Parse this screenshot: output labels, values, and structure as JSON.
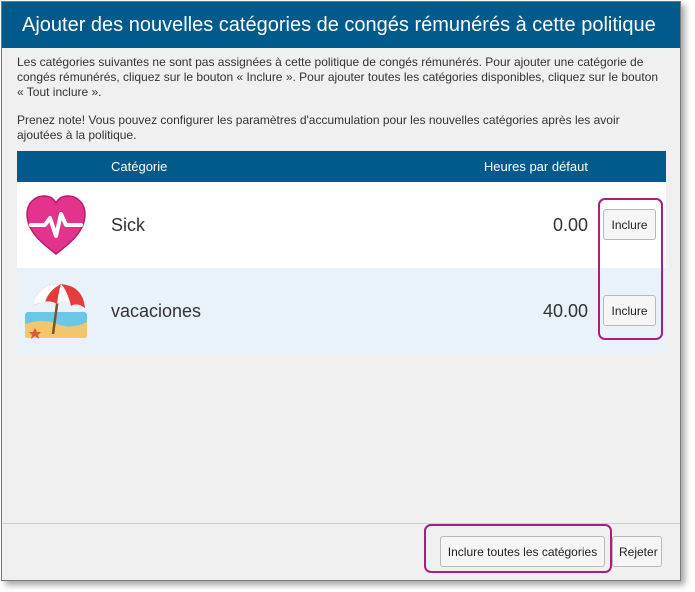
{
  "dialog": {
    "title": "Ajouter des nouvelles catégories de congés rémunérés à cette politique",
    "description": "Les catégories suivantes ne sont pas assignées à cette politique de congés rémunérés. Pour ajouter une catégorie de congés rémunérés, cliquez sur le bouton « Inclure ». Pour ajouter toutes les catégories disponibles, cliquez sur le bouton « Tout inclure ».",
    "note": "Prenez note! Vous pouvez configurer les paramètres d'accumulation pour les nouvelles catégories après les avoir ajoutées à la politique."
  },
  "grid": {
    "columns": {
      "category": "Catégorie",
      "default_hours": "Heures par défaut"
    },
    "rows": [
      {
        "icon": "heart-pulse-icon",
        "name": "Sick",
        "hours": "0.00",
        "button": "Inclure"
      },
      {
        "icon": "beach-umbrella-icon",
        "name": "vacaciones",
        "hours": "40.00",
        "button": "Inclure"
      }
    ]
  },
  "footer": {
    "include_all_label": "Inclure toutes les catégories",
    "reject_label": "Rejeter"
  },
  "colors": {
    "header": "#005a8c",
    "highlight": "#a6207f",
    "alt_row": "#e9f1f9",
    "heart": "#e3338d"
  }
}
